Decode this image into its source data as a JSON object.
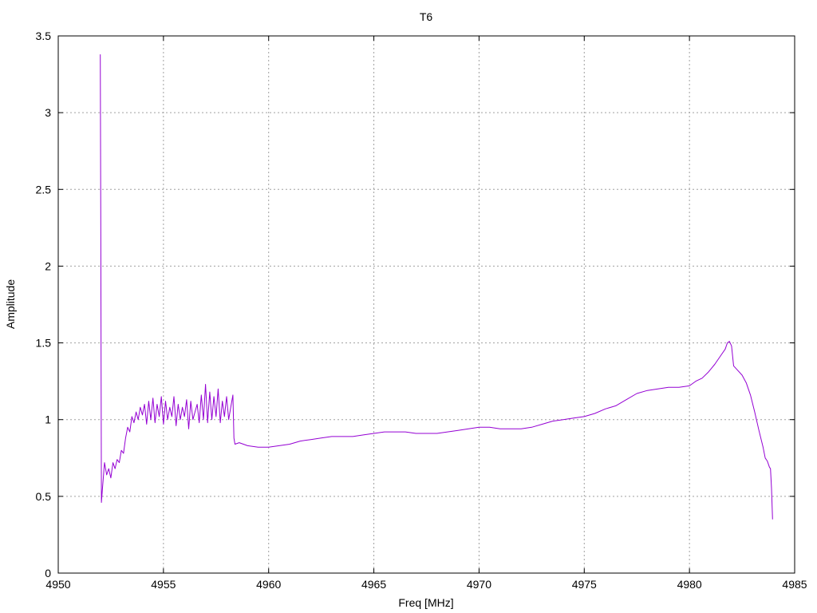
{
  "chart_data": {
    "type": "line",
    "title": "T6",
    "xlabel": "Freq [MHz]",
    "ylabel": "Amplitude",
    "xlim": [
      4950,
      4985
    ],
    "ylim": [
      0,
      3.5
    ],
    "grid": true,
    "x_ticks": [
      "4950",
      "4955",
      "4960",
      "4965",
      "4970",
      "4975",
      "4980",
      "4985"
    ],
    "y_ticks": [
      "0",
      "0.5",
      "1",
      "1.5",
      "2",
      "2.5",
      "3",
      "3.5"
    ],
    "line_color": "#9400d3",
    "series": [
      {
        "x": [
          4952.0,
          4952.02,
          4952.05,
          4952.1,
          4952.2,
          4952.3,
          4952.4,
          4952.5,
          4952.6,
          4952.7,
          4952.8,
          4952.9,
          4953.0,
          4953.1,
          4953.2,
          4953.3,
          4953.4,
          4953.5,
          4953.6,
          4953.7,
          4953.8,
          4953.9,
          4954.0,
          4954.1,
          4954.2,
          4954.3,
          4954.4,
          4954.5,
          4954.6,
          4954.7,
          4954.8,
          4954.9,
          4955.0,
          4955.1,
          4955.2,
          4955.3,
          4955.4,
          4955.5,
          4955.6,
          4955.7,
          4955.8,
          4955.9,
          4956.0,
          4956.1,
          4956.2,
          4956.3,
          4956.4,
          4956.5,
          4956.6,
          4956.7,
          4956.8,
          4956.9,
          4957.0,
          4957.1,
          4957.2,
          4957.3,
          4957.4,
          4957.5,
          4957.6,
          4957.7,
          4957.8,
          4957.9,
          4958.0,
          4958.1,
          4958.2,
          4958.3,
          4958.35,
          4958.4,
          4958.6,
          4958.8,
          4959.0,
          4959.5,
          4960.0,
          4960.5,
          4961.0,
          4961.5,
          4962.0,
          4962.5,
          4963.0,
          4963.5,
          4964.0,
          4964.5,
          4965.0,
          4965.5,
          4966.0,
          4966.5,
          4967.0,
          4967.5,
          4968.0,
          4968.5,
          4969.0,
          4969.5,
          4970.0,
          4970.5,
          4971.0,
          4971.5,
          4972.0,
          4972.5,
          4973.0,
          4973.5,
          4974.0,
          4974.5,
          4975.0,
          4975.5,
          4976.0,
          4976.5,
          4977.0,
          4977.5,
          4978.0,
          4978.5,
          4979.0,
          4979.5,
          4980.0,
          4980.3,
          4980.6,
          4980.9,
          4981.2,
          4981.5,
          4981.7,
          4981.8,
          4981.9,
          4982.0,
          4982.1,
          4982.3,
          4982.5,
          4982.7,
          4982.9,
          4983.1,
          4983.3,
          4983.5,
          4983.6,
          4983.7,
          4983.8,
          4983.85,
          4983.9,
          4983.95
        ],
        "y": [
          3.38,
          2.3,
          0.46,
          0.55,
          0.72,
          0.64,
          0.68,
          0.62,
          0.72,
          0.68,
          0.74,
          0.72,
          0.8,
          0.78,
          0.88,
          0.95,
          0.92,
          1.02,
          0.98,
          1.05,
          1.0,
          1.08,
          1.03,
          1.1,
          0.97,
          1.12,
          1.0,
          1.14,
          0.98,
          1.1,
          1.02,
          1.15,
          0.97,
          1.12,
          1.0,
          1.08,
          1.02,
          1.15,
          0.96,
          1.1,
          1.0,
          1.08,
          1.02,
          1.13,
          0.94,
          1.12,
          1.0,
          1.05,
          1.1,
          0.98,
          1.16,
          1.0,
          1.23,
          0.98,
          1.18,
          1.0,
          1.15,
          1.02,
          1.2,
          0.98,
          1.12,
          1.02,
          1.15,
          1.0,
          1.08,
          1.16,
          0.88,
          0.84,
          0.85,
          0.84,
          0.83,
          0.82,
          0.82,
          0.83,
          0.84,
          0.86,
          0.87,
          0.88,
          0.89,
          0.89,
          0.89,
          0.9,
          0.91,
          0.92,
          0.92,
          0.92,
          0.91,
          0.91,
          0.91,
          0.92,
          0.93,
          0.94,
          0.95,
          0.95,
          0.94,
          0.94,
          0.94,
          0.95,
          0.97,
          0.99,
          1.0,
          1.01,
          1.02,
          1.04,
          1.07,
          1.09,
          1.13,
          1.17,
          1.19,
          1.2,
          1.21,
          1.21,
          1.22,
          1.25,
          1.27,
          1.31,
          1.36,
          1.42,
          1.46,
          1.5,
          1.51,
          1.48,
          1.35,
          1.32,
          1.29,
          1.24,
          1.16,
          1.05,
          0.93,
          0.82,
          0.75,
          0.73,
          0.69,
          0.68,
          0.55,
          0.35
        ]
      }
    ]
  }
}
